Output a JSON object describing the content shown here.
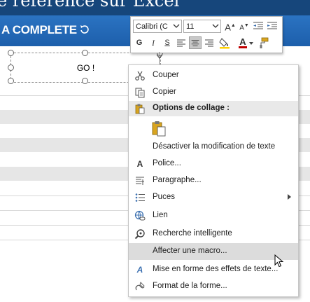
{
  "sheet": {
    "title_fragment": "e référence sur Excel",
    "header_fragment": "A COMPLETE",
    "shape_text": "GO !"
  },
  "mini_toolbar": {
    "font_name": "Calibri (C",
    "font_size": "11",
    "grow_font_label": "A",
    "shrink_font_label": "A",
    "bold_label": "G",
    "italic_label": "I",
    "underline_label": "S",
    "font_color_label": "A",
    "accent_color": "#c00000"
  },
  "context_menu": {
    "items": [
      {
        "icon": "scissors-icon",
        "label": "Couper"
      },
      {
        "icon": "copy-icon",
        "label": "Copier"
      },
      {
        "icon": "clipboard-icon",
        "label": "Options de collage :"
      },
      {
        "icon": "paste-icon",
        "label": ""
      },
      {
        "icon": "",
        "label": "Désactiver la modification de texte"
      },
      {
        "icon": "font-icon",
        "label": "Police..."
      },
      {
        "icon": "paragraph-icon",
        "label": "Paragraphe..."
      },
      {
        "icon": "bullets-icon",
        "label": "Puces"
      },
      {
        "icon": "link-icon",
        "label": "Lien"
      },
      {
        "icon": "smart-lookup-icon",
        "label": "Recherche intelligente"
      },
      {
        "icon": "",
        "label": "Affecter une macro..."
      },
      {
        "icon": "text-effects-icon",
        "label": "Mise en forme des effets de texte..."
      },
      {
        "icon": "format-shape-icon",
        "label": "Format de la forme..."
      }
    ],
    "highlighted_item": "Affecter une macro...",
    "highlight_color": "#dcdcdc"
  },
  "colors": {
    "header_blue": "#2b73c2",
    "title_blue": "#16467b"
  }
}
